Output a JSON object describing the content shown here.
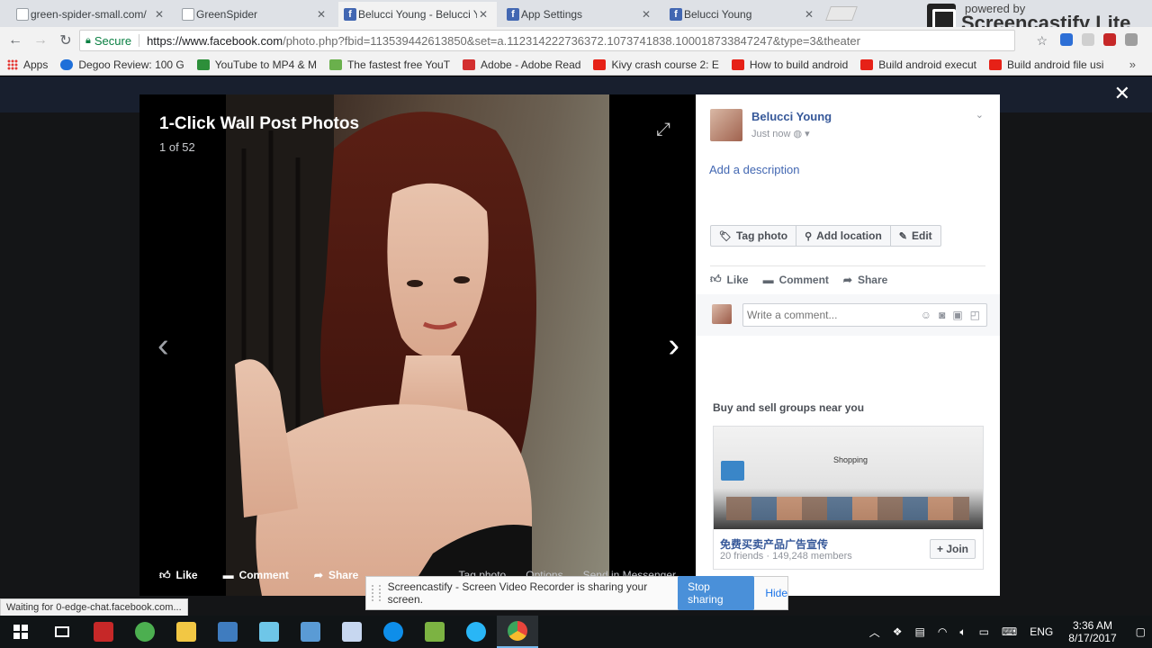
{
  "tabs": [
    {
      "title": "green-spider-small.com/",
      "favicon": "page",
      "active": false
    },
    {
      "title": "GreenSpider",
      "favicon": "page",
      "active": false
    },
    {
      "title": "Belucci Young - Belucci Y",
      "favicon": "facebook",
      "active": true
    },
    {
      "title": "App Settings",
      "favicon": "facebook",
      "active": false
    },
    {
      "title": "Belucci Young",
      "favicon": "facebook",
      "active": false
    }
  ],
  "screencastify_brand": {
    "powered": "powered by",
    "name": "Screencastify Lite"
  },
  "address": {
    "secure_label": "Secure",
    "url_scheme_host": "https://www.facebook.com",
    "url_path": "/photo.php?fbid=113539442613850&set=a.112314222736372.1073741838.100018733847247&type=3&theater"
  },
  "bookmarks": [
    {
      "label": "Apps",
      "icon": "apps-grid-icon",
      "color": "#e53935"
    },
    {
      "label": "Degoo Review: 100 G",
      "icon": "cloud-icon",
      "color": "#1e6fd9"
    },
    {
      "label": "YouTube to MP4 & M",
      "icon": "swirl-icon",
      "color": "#2d8f3a"
    },
    {
      "label": "The fastest free YouT",
      "icon": "download-arrow-icon",
      "color": "#6ab04c"
    },
    {
      "label": "Adobe - Adobe Read",
      "icon": "adobe-icon",
      "color": "#d32f2f"
    },
    {
      "label": "Kivy crash course 2: E",
      "icon": "youtube-icon",
      "color": "#e62117"
    },
    {
      "label": "How to build android",
      "icon": "youtube-icon",
      "color": "#e62117"
    },
    {
      "label": "Build android execut",
      "icon": "youtube-icon",
      "color": "#e62117"
    },
    {
      "label": "Build android file usi",
      "icon": "youtube-icon",
      "color": "#e62117"
    }
  ],
  "photo_viewer": {
    "title": "1-Click Wall Post Photos",
    "count": "1 of 52",
    "actions": {
      "like": "Like",
      "comment": "Comment",
      "share": "Share"
    },
    "secondary": {
      "tag": "Tag photo",
      "options": "Options",
      "messenger": "Send in Messenger"
    }
  },
  "sidebar": {
    "poster_name": "Belucci Young",
    "timestamp": "Just now",
    "add_description": "Add a description",
    "tag_buttons": {
      "tag": "Tag photo",
      "location": "Add location",
      "edit": "Edit"
    },
    "reactions": {
      "like": "Like",
      "comment": "Comment",
      "share": "Share"
    },
    "comment_placeholder": "Write a comment...",
    "groups_heading": "Buy and sell groups near you",
    "group": {
      "name": "免费买卖产品广告宣传",
      "meta": "20 friends · 149,248 members",
      "join": "+ Join",
      "image_caption": "Shopping"
    }
  },
  "status_text": "Waiting for 0-edge-chat.facebook.com...",
  "screen_share": {
    "message": "Screencastify - Screen Video Recorder is sharing your screen.",
    "stop": "Stop sharing",
    "hide": "Hide"
  },
  "taskbar": {
    "apps": [
      {
        "name": "flashget-icon",
        "color": "#c62828"
      },
      {
        "name": "utorrent-icon",
        "color": "#4caf50"
      },
      {
        "name": "file-explorer-icon",
        "color": "#f2c744"
      },
      {
        "name": "python-idle-icon",
        "color": "#3f7cbf"
      },
      {
        "name": "ice-app-icon",
        "color": "#6ec6e8"
      },
      {
        "name": "virtualbox-icon",
        "color": "#5a9bd5"
      },
      {
        "name": "notes-app-icon",
        "color": "#c7d7f0"
      },
      {
        "name": "teamviewer-icon",
        "color": "#0e8ee9"
      },
      {
        "name": "notepad-plus-icon",
        "color": "#7cb342"
      },
      {
        "name": "orbit-app-icon",
        "color": "#29b6f6"
      },
      {
        "name": "chrome-icon",
        "color": "#e8453c",
        "active": true
      }
    ],
    "language": "ENG",
    "time": "3:36 AM",
    "date": "8/17/2017"
  }
}
